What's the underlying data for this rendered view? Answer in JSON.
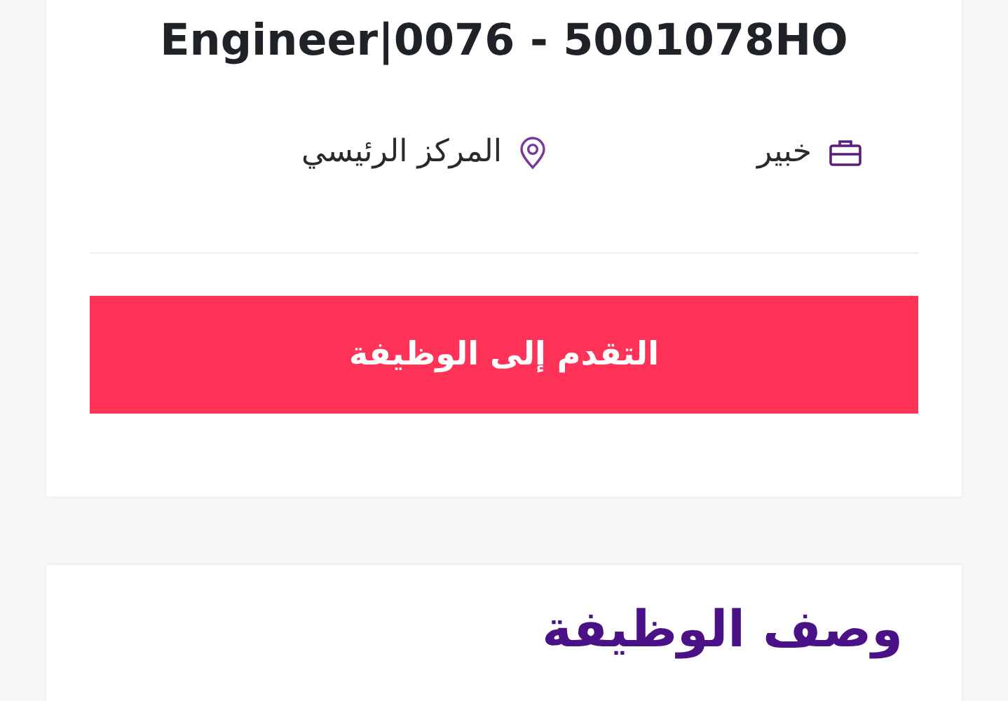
{
  "job_card": {
    "title": "Engineer|0076 - 5001078HO",
    "meta": [
      {
        "kind": "level",
        "text": "خبير"
      },
      {
        "kind": "location",
        "text": "المركز الرئيسي"
      }
    ],
    "apply_button": "التقدم إلى الوظيفة"
  },
  "description_card": {
    "heading": "وصف الوظيفة"
  }
}
